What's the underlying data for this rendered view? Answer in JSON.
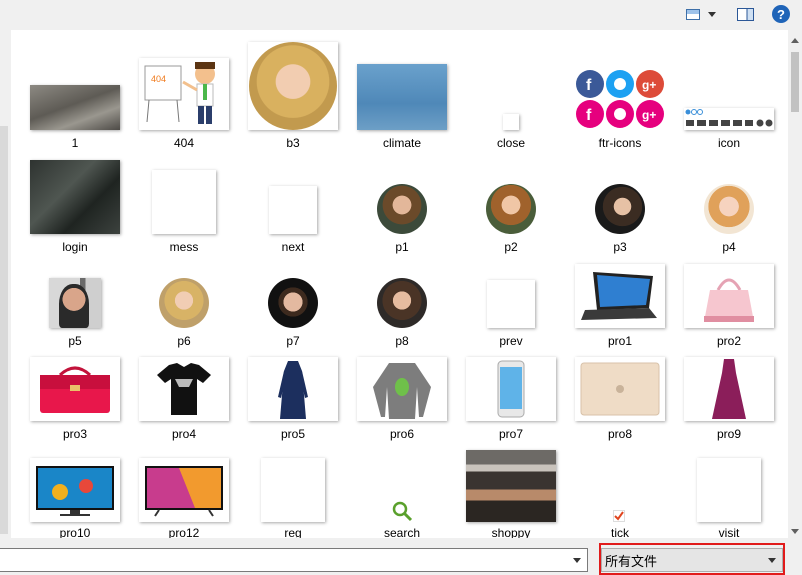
{
  "toolbar": {
    "view_icon": "view-options-icon",
    "pane_icon": "preview-pane-icon",
    "help_label": "?"
  },
  "files": [
    {
      "name": "1"
    },
    {
      "name": "404"
    },
    {
      "name": "b3"
    },
    {
      "name": "climate"
    },
    {
      "name": "close"
    },
    {
      "name": "ftr-icons"
    },
    {
      "name": "icon"
    },
    {
      "name": "login"
    },
    {
      "name": "mess"
    },
    {
      "name": "next"
    },
    {
      "name": "p1"
    },
    {
      "name": "p2"
    },
    {
      "name": "p3"
    },
    {
      "name": "p4"
    },
    {
      "name": "p5"
    },
    {
      "name": "p6"
    },
    {
      "name": "p7"
    },
    {
      "name": "p8"
    },
    {
      "name": "prev"
    },
    {
      "name": "pro1"
    },
    {
      "name": "pro2"
    },
    {
      "name": "pro3"
    },
    {
      "name": "pro4"
    },
    {
      "name": "pro5"
    },
    {
      "name": "pro6"
    },
    {
      "name": "pro7"
    },
    {
      "name": "pro8"
    },
    {
      "name": "pro9"
    },
    {
      "name": "pro10"
    },
    {
      "name": "pro12"
    },
    {
      "name": "reg"
    },
    {
      "name": "search"
    },
    {
      "name": "shoppy"
    },
    {
      "name": "tick"
    },
    {
      "name": "visit"
    }
  ],
  "filename_input": {
    "value": ""
  },
  "filetype": {
    "selected": "所有文件"
  },
  "colors": {
    "highlight": "#e11b1b",
    "help": "#1f64b8"
  }
}
